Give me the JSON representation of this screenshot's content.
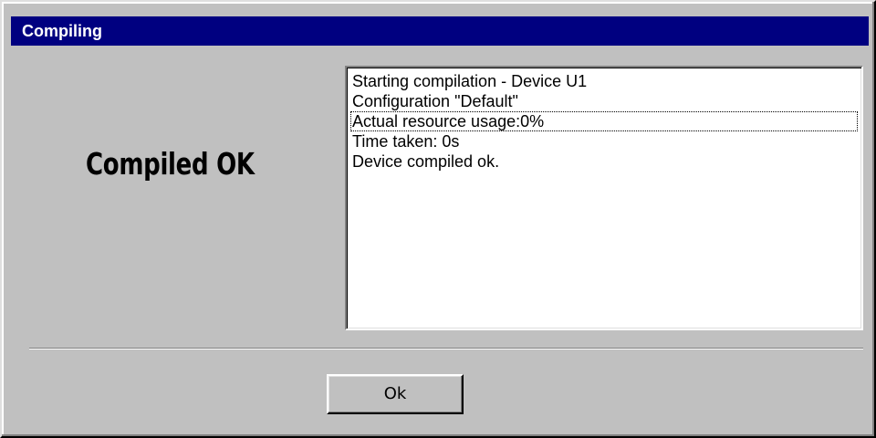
{
  "window": {
    "title": "Compiling"
  },
  "status": {
    "message": "Compiled OK"
  },
  "log": {
    "lines": [
      "Starting compilation - Device U1",
      "Configuration \"Default\"",
      "Actual resource usage:0%",
      "Time taken: 0s",
      "Device compiled ok."
    ],
    "focused_line_index": 2
  },
  "buttons": {
    "ok_label": "Ok"
  },
  "colors": {
    "titlebar": "#000080",
    "dialog_face": "#c0c0c0",
    "log_background": "#ffffff"
  }
}
